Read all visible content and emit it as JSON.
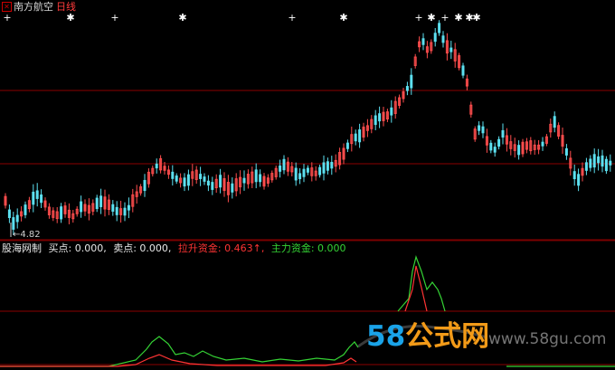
{
  "title_bar": {
    "stock_name": "南方航空",
    "period": "日线"
  },
  "price_panel": {
    "low_label": "4.82",
    "signal_marker": "✱",
    "cross_marker": "+",
    "colors": {
      "up": "#ff4d4d",
      "down": "#5ce0f0",
      "grid": "#8b0000"
    }
  },
  "indicator_bar": {
    "name": "股海网制",
    "buy_label": "买点: 0.000,",
    "sell_label": "卖点: 0.000,",
    "lift_label": "拉升资金: 0.463↑,",
    "main_label": "主力资金: 0.000"
  },
  "watermark": {
    "digits": "58",
    "brand": "公式网",
    "url": "www.58gu.com"
  }
}
